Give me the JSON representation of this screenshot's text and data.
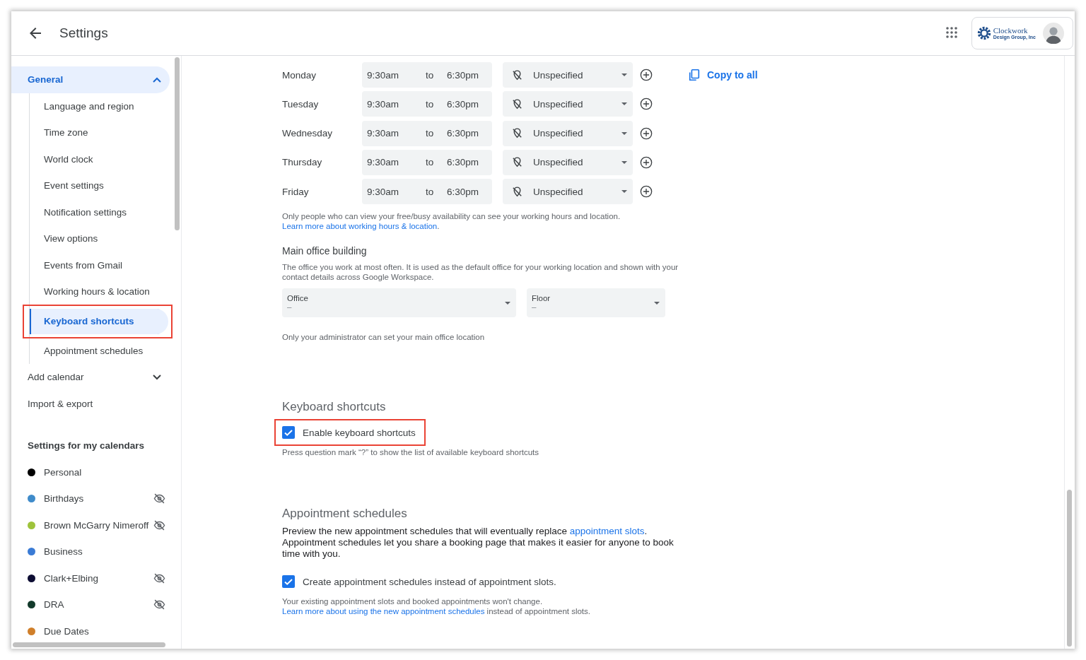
{
  "window": {
    "title": "Settings"
  },
  "account": {
    "logo_name": "Clockwork",
    "logo_tagline": "Design Group, Inc"
  },
  "sidebar": {
    "items": [
      {
        "label": "General",
        "expanded": true,
        "children": [
          {
            "label": "Language and region",
            "selected": false,
            "highlighted": false
          },
          {
            "label": "Time zone",
            "selected": false,
            "highlighted": false
          },
          {
            "label": "World clock",
            "selected": false,
            "highlighted": false
          },
          {
            "label": "Event settings",
            "selected": false,
            "highlighted": false
          },
          {
            "label": "Notification settings",
            "selected": false,
            "highlighted": false
          },
          {
            "label": "View options",
            "selected": false,
            "highlighted": false
          },
          {
            "label": "Events from Gmail",
            "selected": false,
            "highlighted": false
          },
          {
            "label": "Working hours & location",
            "selected": false,
            "highlighted": false
          },
          {
            "label": "Keyboard shortcuts",
            "selected": true,
            "highlighted": true
          },
          {
            "label": "Appointment schedules",
            "selected": false,
            "highlighted": false
          }
        ]
      },
      {
        "label": "Add calendar",
        "expanded": false
      },
      {
        "label": "Import & export"
      }
    ],
    "calendars_heading": "Settings for my calendars",
    "calendars": [
      {
        "name": "Personal",
        "color": "#000000",
        "hidden": false
      },
      {
        "name": "Birthdays",
        "color": "#3f8bca",
        "hidden": true
      },
      {
        "name": "Brown McGarry Nimeroff",
        "color": "#9ec33b",
        "hidden": true
      },
      {
        "name": "Business",
        "color": "#3a7bd5",
        "hidden": false
      },
      {
        "name": "Clark+Elbing",
        "color": "#0d0d33",
        "hidden": true
      },
      {
        "name": "DRA",
        "color": "#133a2b",
        "hidden": true
      },
      {
        "name": "Due Dates",
        "color": "#d07f2a",
        "hidden": false
      }
    ]
  },
  "working_hours": {
    "days": [
      {
        "day": "Monday",
        "start": "9:30am",
        "separator": "to",
        "end": "6:30pm",
        "location": "Unspecified"
      },
      {
        "day": "Tuesday",
        "start": "9:30am",
        "separator": "to",
        "end": "6:30pm",
        "location": "Unspecified"
      },
      {
        "day": "Wednesday",
        "start": "9:30am",
        "separator": "to",
        "end": "6:30pm",
        "location": "Unspecified"
      },
      {
        "day": "Thursday",
        "start": "9:30am",
        "separator": "to",
        "end": "6:30pm",
        "location": "Unspecified"
      },
      {
        "day": "Friday",
        "start": "9:30am",
        "separator": "to",
        "end": "6:30pm",
        "location": "Unspecified"
      }
    ],
    "copy_button": "Copy to all",
    "note": "Only people who can view your free/busy availability can see your working hours and location.",
    "link": "Learn more about working hours & location",
    "link_after": "."
  },
  "main_office": {
    "heading": "Main office building",
    "description": "The office you work at most often. It is used as the default office for your working location and shown with your contact details across Google Workspace.",
    "fields": [
      {
        "label": "Office",
        "value": "–"
      },
      {
        "label": "Floor",
        "value": "–"
      }
    ],
    "note": "Only your administrator can set your main office location"
  },
  "keyboard_shortcuts": {
    "heading": "Keyboard shortcuts",
    "checkbox": {
      "label": "Enable keyboard shortcuts",
      "checked": true,
      "highlighted": true
    },
    "note": "Press question mark “?” to show the list of available keyboard shortcuts"
  },
  "appointment_schedules": {
    "heading": "Appointment schedules",
    "description": [
      {
        "kind": "text",
        "text": "Preview the new appointment schedules that will eventually replace "
      },
      {
        "kind": "link",
        "text": "appointment slots"
      },
      {
        "kind": "text",
        "text": ". Appointment schedules let you share a booking page that makes it easier for anyone to book time with you."
      }
    ],
    "checkbox": {
      "label": "Create appointment schedules instead of appointment slots.",
      "checked": true
    },
    "note": [
      {
        "kind": "text",
        "text": "Your existing appointment slots and booked appointments won't change. "
      },
      {
        "kind": "link",
        "text": "Learn more about using the new appointment schedules"
      },
      {
        "kind": "text",
        "text": " instead of appointment slots."
      }
    ]
  }
}
